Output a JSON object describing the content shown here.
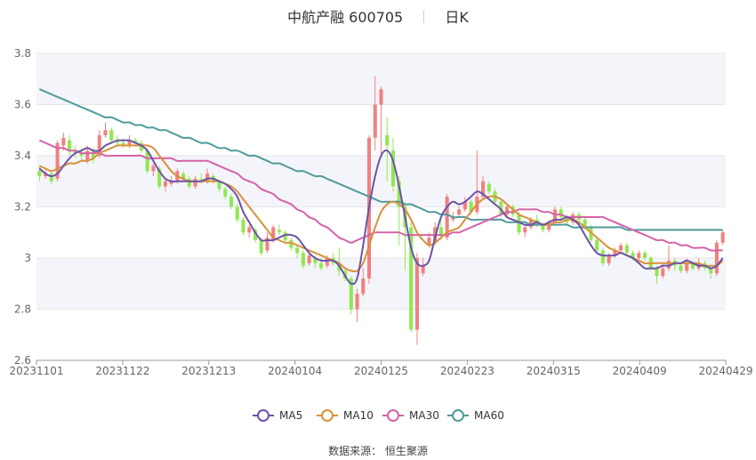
{
  "header": {
    "name": "中航产融 600705",
    "period": "日K"
  },
  "source": "数据来源： 恒生聚源",
  "colors": {
    "up": "#f28080",
    "down": "#8fe850",
    "ma5": "#6e52a8",
    "ma10": "#d9913b",
    "ma30": "#d562a8",
    "ma60": "#4f9b9b",
    "grid": "#e6e6e6",
    "band": "#f4f5fa"
  },
  "chart_data": {
    "type": "candlestick",
    "ylim": [
      2.6,
      3.8
    ],
    "yticks": [
      "2.6",
      "2.8",
      "3",
      "3.2",
      "3.4",
      "3.6",
      "3.8"
    ],
    "xticks": [
      "20231101",
      "20231122",
      "20231213",
      "20240104",
      "20240125",
      "20240223",
      "20240315",
      "20240409",
      "20240429"
    ],
    "legend": [
      "MA5",
      "MA10",
      "MA30",
      "MA60"
    ],
    "candles": [
      [
        3.34,
        3.32,
        3.36,
        3.3
      ],
      [
        3.32,
        3.33,
        3.35,
        3.31
      ],
      [
        3.33,
        3.3,
        3.34,
        3.29
      ],
      [
        3.31,
        3.45,
        3.46,
        3.3
      ],
      [
        3.44,
        3.47,
        3.49,
        3.42
      ],
      [
        3.46,
        3.42,
        3.48,
        3.4
      ],
      [
        3.42,
        3.41,
        3.44,
        3.39
      ],
      [
        3.41,
        3.4,
        3.43,
        3.38
      ],
      [
        3.38,
        3.42,
        3.44,
        3.37
      ],
      [
        3.42,
        3.39,
        3.43,
        3.37
      ],
      [
        3.4,
        3.48,
        3.5,
        3.39
      ],
      [
        3.48,
        3.5,
        3.53,
        3.47
      ],
      [
        3.5,
        3.46,
        3.51,
        3.45
      ],
      [
        3.46,
        3.45,
        3.48,
        3.44
      ],
      [
        3.45,
        3.44,
        3.47,
        3.43
      ],
      [
        3.44,
        3.46,
        3.48,
        3.43
      ],
      [
        3.46,
        3.45,
        3.47,
        3.44
      ],
      [
        3.45,
        3.42,
        3.46,
        3.41
      ],
      [
        3.42,
        3.34,
        3.43,
        3.33
      ],
      [
        3.34,
        3.36,
        3.37,
        3.32
      ],
      [
        3.35,
        3.28,
        3.36,
        3.27
      ],
      [
        3.28,
        3.3,
        3.31,
        3.26
      ],
      [
        3.29,
        3.3,
        3.32,
        3.28
      ],
      [
        3.3,
        3.34,
        3.35,
        3.29
      ],
      [
        3.33,
        3.31,
        3.34,
        3.3
      ],
      [
        3.31,
        3.28,
        3.32,
        3.27
      ],
      [
        3.28,
        3.31,
        3.32,
        3.27
      ],
      [
        3.31,
        3.3,
        3.33,
        3.29
      ],
      [
        3.3,
        3.33,
        3.35,
        3.29
      ],
      [
        3.32,
        3.3,
        3.33,
        3.29
      ],
      [
        3.3,
        3.27,
        3.31,
        3.26
      ],
      [
        3.27,
        3.24,
        3.28,
        3.23
      ],
      [
        3.24,
        3.2,
        3.25,
        3.19
      ],
      [
        3.2,
        3.15,
        3.21,
        3.14
      ],
      [
        3.15,
        3.1,
        3.16,
        3.09
      ],
      [
        3.1,
        3.12,
        3.13,
        3.08
      ],
      [
        3.11,
        3.07,
        3.12,
        3.06
      ],
      [
        3.07,
        3.02,
        3.08,
        3.01
      ],
      [
        3.03,
        3.08,
        3.1,
        3.02
      ],
      [
        3.07,
        3.12,
        3.13,
        3.06
      ],
      [
        3.11,
        3.1,
        3.13,
        3.09
      ],
      [
        3.1,
        3.07,
        3.11,
        3.06
      ],
      [
        3.07,
        3.04,
        3.08,
        3.03
      ],
      [
        3.04,
        3.02,
        3.05,
        3.0
      ],
      [
        3.02,
        2.97,
        3.03,
        2.96
      ],
      [
        2.98,
        3.01,
        3.02,
        2.97
      ],
      [
        3.0,
        2.98,
        3.01,
        2.96
      ],
      [
        2.98,
        2.96,
        3.0,
        2.95
      ],
      [
        2.97,
        3.0,
        3.01,
        2.96
      ],
      [
        3.0,
        2.98,
        3.02,
        2.97
      ],
      [
        2.98,
        2.95,
        3.04,
        2.93
      ],
      [
        2.95,
        2.92,
        2.96,
        2.91
      ],
      [
        2.92,
        2.8,
        2.93,
        2.78
      ],
      [
        2.8,
        2.86,
        2.88,
        2.75
      ],
      [
        2.86,
        2.92,
        2.96,
        2.85
      ],
      [
        2.92,
        3.47,
        3.48,
        2.9
      ],
      [
        3.47,
        3.6,
        3.71,
        3.42
      ],
      [
        3.6,
        3.66,
        3.67,
        3.4
      ],
      [
        3.48,
        3.44,
        3.55,
        3.3
      ],
      [
        3.42,
        3.28,
        3.47,
        3.26
      ],
      [
        3.3,
        3.2,
        3.32,
        3.05
      ],
      [
        3.2,
        3.12,
        3.22,
        2.95
      ],
      [
        3.12,
        2.72,
        3.14,
        2.71
      ],
      [
        2.72,
        3.0,
        3.02,
        2.66
      ],
      [
        2.94,
        2.97,
        3.0,
        2.93
      ],
      [
        3.05,
        3.08,
        3.1,
        3.04
      ],
      [
        3.06,
        3.12,
        3.14,
        3.05
      ],
      [
        3.12,
        3.09,
        3.15,
        3.07
      ],
      [
        3.08,
        3.24,
        3.25,
        3.07
      ],
      [
        3.15,
        3.16,
        3.18,
        3.14
      ],
      [
        3.17,
        3.19,
        3.2,
        3.16
      ],
      [
        3.19,
        3.22,
        3.24,
        3.18
      ],
      [
        3.22,
        3.18,
        3.23,
        3.17
      ],
      [
        3.18,
        3.24,
        3.42,
        3.17
      ],
      [
        3.24,
        3.3,
        3.32,
        3.23
      ],
      [
        3.29,
        3.26,
        3.3,
        3.25
      ],
      [
        3.26,
        3.22,
        3.27,
        3.21
      ],
      [
        3.22,
        3.17,
        3.23,
        3.16
      ],
      [
        3.17,
        3.2,
        3.21,
        3.16
      ],
      [
        3.2,
        3.17,
        3.21,
        3.16
      ],
      [
        3.17,
        3.1,
        3.18,
        3.09
      ],
      [
        3.1,
        3.12,
        3.13,
        3.08
      ],
      [
        3.12,
        3.15,
        3.16,
        3.11
      ],
      [
        3.15,
        3.13,
        3.17,
        3.12
      ],
      [
        3.13,
        3.11,
        3.14,
        3.1
      ],
      [
        3.11,
        3.14,
        3.15,
        3.1
      ],
      [
        3.14,
        3.19,
        3.2,
        3.13
      ],
      [
        3.19,
        3.16,
        3.2,
        3.15
      ],
      [
        3.16,
        3.14,
        3.17,
        3.13
      ],
      [
        3.14,
        3.17,
        3.18,
        3.13
      ],
      [
        3.17,
        3.15,
        3.18,
        3.14
      ],
      [
        3.15,
        3.12,
        3.16,
        3.11
      ],
      [
        3.12,
        3.07,
        3.13,
        3.06
      ],
      [
        3.07,
        3.03,
        3.08,
        3.02
      ],
      [
        3.03,
        2.98,
        3.04,
        2.97
      ],
      [
        2.98,
        3.01,
        3.02,
        2.97
      ],
      [
        3.01,
        3.03,
        3.04,
        3.0
      ],
      [
        3.03,
        3.05,
        3.06,
        3.02
      ],
      [
        3.05,
        3.02,
        3.06,
        3.01
      ],
      [
        3.02,
        3.0,
        3.03,
        2.99
      ],
      [
        3.0,
        3.02,
        3.03,
        2.99
      ],
      [
        3.02,
        3.0,
        3.03,
        2.99
      ],
      [
        3.0,
        2.96,
        3.01,
        2.95
      ],
      [
        2.96,
        2.93,
        2.97,
        2.9
      ],
      [
        2.93,
        2.96,
        2.98,
        2.92
      ],
      [
        2.96,
        2.99,
        3.05,
        2.95
      ],
      [
        2.99,
        2.97,
        3.0,
        2.95
      ],
      [
        2.97,
        2.95,
        2.98,
        2.94
      ],
      [
        2.95,
        2.98,
        3.0,
        2.94
      ],
      [
        2.98,
        2.96,
        2.99,
        2.95
      ],
      [
        2.96,
        2.98,
        3.0,
        2.95
      ],
      [
        2.98,
        2.96,
        2.99,
        2.95
      ],
      [
        2.96,
        2.94,
        2.97,
        2.92
      ],
      [
        2.94,
        3.06,
        3.07,
        2.93
      ],
      [
        3.06,
        3.1,
        3.11,
        3.05
      ]
    ],
    "ma5": [
      3.35,
      3.33,
      3.32,
      3.33,
      3.36,
      3.39,
      3.41,
      3.42,
      3.43,
      3.42,
      3.42,
      3.44,
      3.45,
      3.46,
      3.46,
      3.46,
      3.45,
      3.44,
      3.42,
      3.38,
      3.34,
      3.31,
      3.3,
      3.3,
      3.3,
      3.3,
      3.3,
      3.3,
      3.31,
      3.31,
      3.3,
      3.29,
      3.27,
      3.24,
      3.18,
      3.14,
      3.1,
      3.07,
      3.07,
      3.07,
      3.08,
      3.09,
      3.09,
      3.08,
      3.05,
      3.02,
      3.0,
      2.99,
      2.99,
      2.99,
      2.97,
      2.93,
      2.9,
      2.92,
      3.05,
      3.2,
      3.32,
      3.4,
      3.42,
      3.38,
      3.28,
      3.16,
      3.04,
      2.98,
      2.97,
      2.99,
      3.08,
      3.16,
      3.2,
      3.22,
      3.21,
      3.22,
      3.24,
      3.26,
      3.25,
      3.23,
      3.21,
      3.19,
      3.16,
      3.15,
      3.14,
      3.13,
      3.13,
      3.14,
      3.13,
      3.14,
      3.15,
      3.15,
      3.16,
      3.15,
      3.13,
      3.09,
      3.05,
      3.02,
      3.01,
      3.01,
      3.01,
      3.02,
      3.01,
      3.0,
      2.98,
      2.96,
      2.96,
      2.96,
      2.97,
      2.97,
      2.98,
      2.98,
      2.99,
      2.98,
      2.97,
      2.97,
      2.96,
      2.97,
      3.0
    ],
    "ma10": [
      3.36,
      3.35,
      3.34,
      3.35,
      3.36,
      3.37,
      3.37,
      3.38,
      3.38,
      3.39,
      3.41,
      3.42,
      3.43,
      3.44,
      3.44,
      3.44,
      3.44,
      3.44,
      3.44,
      3.43,
      3.4,
      3.37,
      3.34,
      3.32,
      3.31,
      3.3,
      3.3,
      3.3,
      3.3,
      3.3,
      3.3,
      3.29,
      3.28,
      3.26,
      3.23,
      3.2,
      3.17,
      3.14,
      3.11,
      3.08,
      3.07,
      3.06,
      3.06,
      3.05,
      3.04,
      3.03,
      3.02,
      3.01,
      3.0,
      2.99,
      2.98,
      2.96,
      2.95,
      2.95,
      2.98,
      3.05,
      3.12,
      3.18,
      3.21,
      3.22,
      3.21,
      3.19,
      3.15,
      3.1,
      3.07,
      3.05,
      3.06,
      3.08,
      3.1,
      3.11,
      3.12,
      3.15,
      3.18,
      3.21,
      3.23,
      3.24,
      3.24,
      3.23,
      3.21,
      3.19,
      3.17,
      3.16,
      3.15,
      3.14,
      3.13,
      3.13,
      3.14,
      3.14,
      3.15,
      3.15,
      3.14,
      3.12,
      3.1,
      3.08,
      3.06,
      3.04,
      3.03,
      3.02,
      3.01,
      3.0,
      2.99,
      2.98,
      2.98,
      2.98,
      2.98,
      2.98,
      2.98,
      2.98,
      2.98,
      2.98,
      2.98,
      2.97,
      2.97,
      2.97,
      2.99
    ],
    "ma30": [
      3.46,
      3.45,
      3.44,
      3.43,
      3.43,
      3.42,
      3.42,
      3.41,
      3.41,
      3.41,
      3.41,
      3.4,
      3.4,
      3.4,
      3.4,
      3.4,
      3.4,
      3.4,
      3.39,
      3.39,
      3.39,
      3.39,
      3.39,
      3.38,
      3.38,
      3.38,
      3.38,
      3.38,
      3.38,
      3.37,
      3.36,
      3.35,
      3.34,
      3.33,
      3.31,
      3.3,
      3.29,
      3.27,
      3.26,
      3.25,
      3.23,
      3.22,
      3.21,
      3.19,
      3.18,
      3.16,
      3.15,
      3.13,
      3.12,
      3.1,
      3.08,
      3.07,
      3.06,
      3.07,
      3.08,
      3.09,
      3.1,
      3.1,
      3.1,
      3.1,
      3.1,
      3.09,
      3.09,
      3.09,
      3.09,
      3.09,
      3.09,
      3.09,
      3.09,
      3.1,
      3.1,
      3.11,
      3.12,
      3.13,
      3.14,
      3.15,
      3.16,
      3.17,
      3.18,
      3.18,
      3.19,
      3.19,
      3.19,
      3.19,
      3.18,
      3.18,
      3.17,
      3.17,
      3.16,
      3.16,
      3.16,
      3.16,
      3.16,
      3.16,
      3.16,
      3.15,
      3.14,
      3.13,
      3.12,
      3.11,
      3.1,
      3.09,
      3.08,
      3.07,
      3.07,
      3.06,
      3.06,
      3.05,
      3.05,
      3.04,
      3.04,
      3.04,
      3.03,
      3.03,
      3.03
    ],
    "ma60": [
      3.66,
      3.65,
      3.64,
      3.63,
      3.62,
      3.61,
      3.6,
      3.59,
      3.58,
      3.57,
      3.56,
      3.55,
      3.55,
      3.54,
      3.53,
      3.53,
      3.52,
      3.52,
      3.51,
      3.51,
      3.5,
      3.5,
      3.49,
      3.48,
      3.47,
      3.47,
      3.46,
      3.45,
      3.45,
      3.44,
      3.43,
      3.43,
      3.42,
      3.42,
      3.41,
      3.4,
      3.4,
      3.39,
      3.38,
      3.37,
      3.37,
      3.36,
      3.35,
      3.34,
      3.34,
      3.33,
      3.32,
      3.32,
      3.31,
      3.3,
      3.29,
      3.28,
      3.27,
      3.26,
      3.25,
      3.24,
      3.23,
      3.22,
      3.22,
      3.22,
      3.22,
      3.21,
      3.21,
      3.2,
      3.19,
      3.18,
      3.18,
      3.17,
      3.17,
      3.16,
      3.16,
      3.16,
      3.15,
      3.15,
      3.15,
      3.15,
      3.15,
      3.15,
      3.14,
      3.14,
      3.14,
      3.14,
      3.13,
      3.13,
      3.13,
      3.13,
      3.13,
      3.13,
      3.13,
      3.12,
      3.12,
      3.12,
      3.12,
      3.12,
      3.12,
      3.12,
      3.12,
      3.12,
      3.11,
      3.11,
      3.11,
      3.11,
      3.11,
      3.11,
      3.11,
      3.11,
      3.11,
      3.11,
      3.11,
      3.11,
      3.11,
      3.11,
      3.11,
      3.11,
      3.11
    ]
  }
}
